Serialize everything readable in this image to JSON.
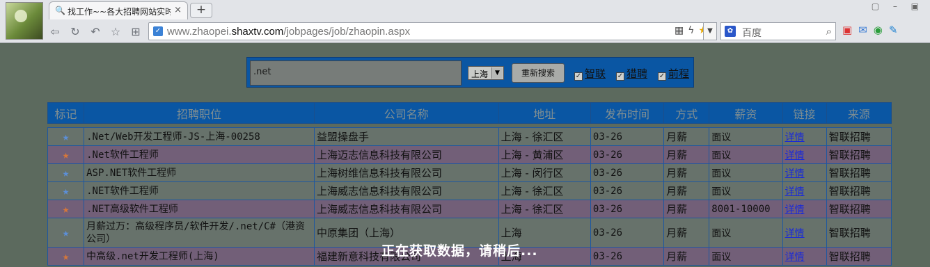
{
  "browser": {
    "tab_title": "找工作~~各大招聘网站实时",
    "tab_close": "×",
    "new_tab": "+",
    "url_prefix": "www.zhaopei.",
    "url_domain": "shaxtv.com",
    "url_path": "/jobpages/job/zhaopin.aspx",
    "search_placeholder": "百度",
    "window_controls": "▢ – ▣"
  },
  "search_form": {
    "keyword": ".net",
    "city": "上海",
    "button": "重新搜索",
    "sources": [
      "智联",
      "猎聘",
      "前程"
    ]
  },
  "table": {
    "headers": [
      "标记",
      "招聘职位",
      "公司名称",
      "地址",
      "发布时间",
      "方式",
      "薪资",
      "链接",
      "来源"
    ],
    "rows": [
      {
        "mark": "★",
        "mark_color": "blue",
        "title": ".Net/Web开发工程师-JS-上海-00258",
        "company": "益盟操盘手",
        "address": "上海 - 徐汇区",
        "date": "03-26",
        "method": "月薪",
        "salary": "面议",
        "link": "详情",
        "source": "智联招聘"
      },
      {
        "mark": "★",
        "mark_color": "orange",
        "title": ".Net软件工程师",
        "company": "上海迈志信息科技有限公司",
        "address": "上海 - 黄浦区",
        "date": "03-26",
        "method": "月薪",
        "salary": "面议",
        "link": "详情",
        "source": "智联招聘"
      },
      {
        "mark": "★",
        "mark_color": "blue",
        "title": "ASP.NET软件工程师",
        "company": "上海树维信息科技有限公司",
        "address": "上海 - 闵行区",
        "date": "03-26",
        "method": "月薪",
        "salary": "面议",
        "link": "详情",
        "source": "智联招聘"
      },
      {
        "mark": "★",
        "mark_color": "blue",
        "title": ".NET软件工程师",
        "company": "上海威志信息科技有限公司",
        "address": "上海 - 徐汇区",
        "date": "03-26",
        "method": "月薪",
        "salary": "面议",
        "link": "详情",
        "source": "智联招聘"
      },
      {
        "mark": "★",
        "mark_color": "orange",
        "title": ".NET高级软件工程师",
        "company": "上海威志信息科技有限公司",
        "address": "上海 - 徐汇区",
        "date": "03-26",
        "method": "月薪",
        "salary": "8001-10000",
        "link": "详情",
        "source": "智联招聘"
      },
      {
        "mark": "★",
        "mark_color": "blue",
        "title": "月薪过万：高级程序员/软件开发/.net/C#（港资公司）",
        "company": "中原集团（上海）",
        "address": "上海",
        "date": "03-26",
        "method": "月薪",
        "salary": "面议",
        "link": "详情",
        "source": "智联招聘"
      },
      {
        "mark": "★",
        "mark_color": "orange",
        "title": "中高级.net开发工程师(上海)",
        "company": "福建新意科技有限公司",
        "address": "上海",
        "date": "03-26",
        "method": "月薪",
        "salary": "面议",
        "link": "详情",
        "source": "智联招聘"
      }
    ]
  },
  "loading_text": "正在获取数据，请稍后...",
  "colors": {
    "header_bg": "#0a56a3",
    "row_odd": "#67726b",
    "row_even": "#725f78",
    "link": "#1a2ad8"
  }
}
